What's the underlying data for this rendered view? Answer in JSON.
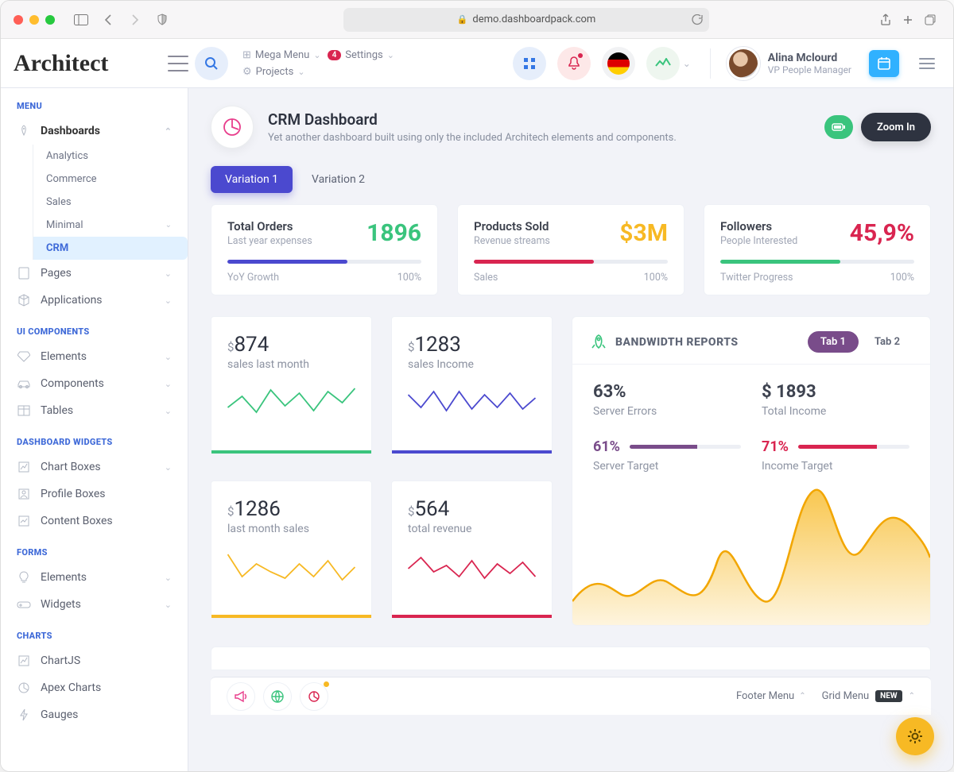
{
  "browser": {
    "url": "demo.dashboardpack.com"
  },
  "brand": "Architect",
  "header": {
    "mega_menu": "Mega Menu",
    "settings": "Settings",
    "settings_badge": "4",
    "projects": "Projects"
  },
  "user": {
    "name": "Alina Mclourd",
    "role": "VP People Manager"
  },
  "page": {
    "title": "CRM Dashboard",
    "subtitle": "Yet another dashboard built using only the included Architech elements and components.",
    "zoom_button": "Zoom In"
  },
  "tabs": {
    "t1": "Variation 1",
    "t2": "Variation 2"
  },
  "sidebar": {
    "heading_menu": "MENU",
    "heading_ui": "UI COMPONENTS",
    "heading_widgets": "DASHBOARD WIDGETS",
    "heading_forms": "FORMS",
    "heading_charts": "CHARTS",
    "dashboards": "Dashboards",
    "analytics": "Analytics",
    "commerce": "Commerce",
    "sales": "Sales",
    "minimal": "Minimal",
    "crm": "CRM",
    "pages": "Pages",
    "applications": "Applications",
    "elements": "Elements",
    "components": "Components",
    "tables": "Tables",
    "chart_boxes": "Chart Boxes",
    "profile_boxes": "Profile Boxes",
    "content_boxes": "Content Boxes",
    "form_elements": "Elements",
    "widgets": "Widgets",
    "chartjs": "ChartJS",
    "apex": "Apex Charts",
    "gauges": "Gauges"
  },
  "stats": [
    {
      "title": "Total Orders",
      "subtitle": "Last year expenses",
      "value": "1896",
      "color": "#3ac47d",
      "bar_color": "#4b49cf",
      "bar_pct": 62,
      "foot_l": "YoY Growth",
      "foot_r": "100%"
    },
    {
      "title": "Products Sold",
      "subtitle": "Revenue streams",
      "value": "$3M",
      "color": "#f7b924",
      "bar_color": "#d92550",
      "bar_pct": 62,
      "foot_l": "Sales",
      "foot_r": "100%"
    },
    {
      "title": "Followers",
      "subtitle": "People Interested",
      "value": "45,9%",
      "color": "#d92550",
      "bar_color": "#3ac47d",
      "bar_pct": 62,
      "foot_l": "Twitter Progress",
      "foot_r": "100%"
    }
  ],
  "minis": [
    {
      "currency": "$",
      "value": "874",
      "label": "sales last month",
      "color": "#3ac47d"
    },
    {
      "currency": "$",
      "value": "1283",
      "label": "sales Income",
      "color": "#4b49cf"
    },
    {
      "currency": "$",
      "value": "1286",
      "label": "last month sales",
      "color": "#f7b924"
    },
    {
      "currency": "$",
      "value": "564",
      "label": "total revenue",
      "color": "#d92550"
    }
  ],
  "bandwidth": {
    "title": "BANDWIDTH REPORTS",
    "tab1": "Tab 1",
    "tab2": "Tab 2",
    "m1_val": "63%",
    "m1_label": "Server Errors",
    "m2_val": "$ 1893",
    "m2_label": "Total Income",
    "t1_pct": "61%",
    "t1_label": "Server Target",
    "t1_color": "#794c8a",
    "t1_bar": 61,
    "t2_pct": "71%",
    "t2_label": "Income Target",
    "t2_color": "#d92550",
    "t2_bar": 71
  },
  "footer": {
    "menu": "Footer Menu",
    "grid": "Grid Menu",
    "new_badge": "NEW"
  },
  "chart_data": [
    {
      "type": "line",
      "series": [
        {
          "name": "sales last month",
          "values": [
            32,
            52,
            28,
            60,
            38,
            56,
            34,
            60,
            46,
            64
          ]
        }
      ],
      "ylim": [
        0,
        80
      ]
    },
    {
      "type": "line",
      "series": [
        {
          "name": "sales income",
          "values": [
            50,
            30,
            55,
            28,
            56,
            30,
            50,
            34,
            54,
            30,
            46
          ]
        }
      ],
      "ylim": [
        0,
        80
      ]
    },
    {
      "type": "line",
      "series": [
        {
          "name": "last month sales",
          "values": [
            60,
            30,
            48,
            36,
            28,
            46,
            30,
            50,
            26,
            42
          ]
        }
      ],
      "ylim": [
        0,
        80
      ]
    },
    {
      "type": "line",
      "series": [
        {
          "name": "total revenue",
          "values": [
            40,
            56,
            36,
            44,
            30,
            52,
            28,
            48,
            34,
            50,
            30
          ]
        }
      ],
      "ylim": [
        0,
        80
      ]
    },
    {
      "type": "area",
      "series": [
        {
          "name": "bandwidth",
          "values": [
            10,
            35,
            12,
            28,
            8,
            55,
            20,
            95,
            30,
            70,
            88,
            65
          ]
        }
      ],
      "ylim": [
        0,
        100
      ]
    }
  ]
}
